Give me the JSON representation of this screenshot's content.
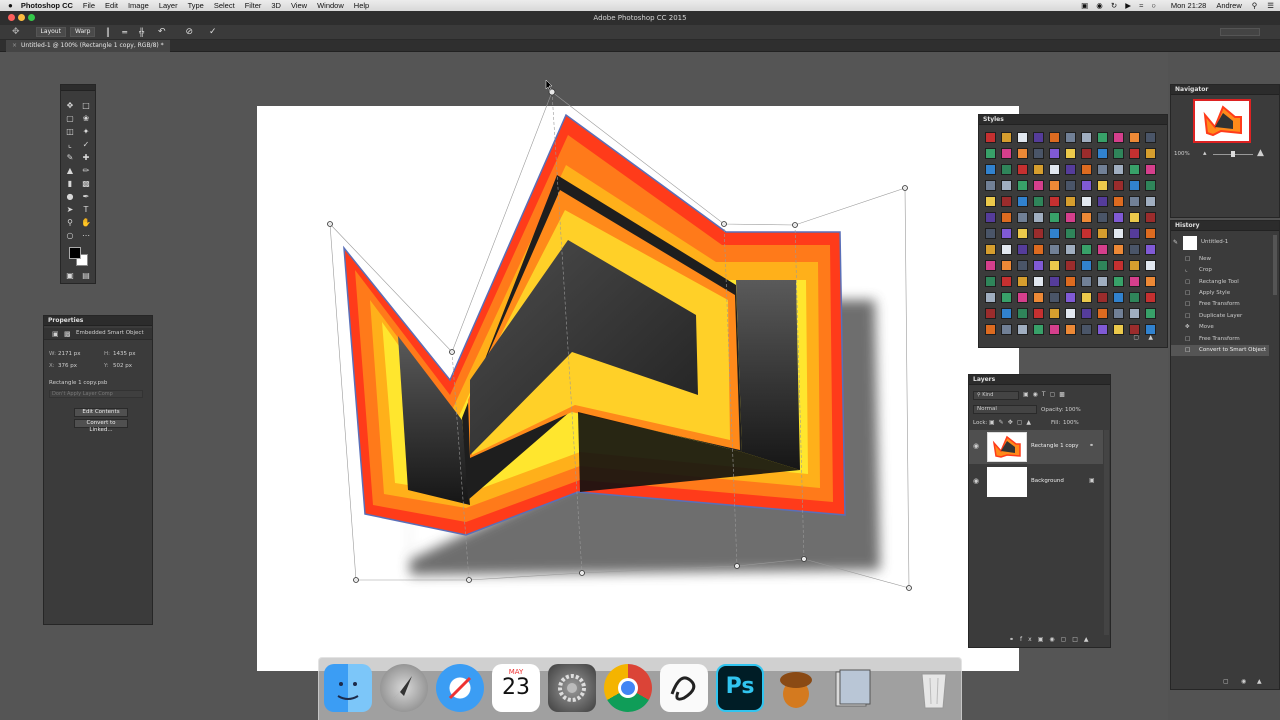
{
  "menubar": {
    "app_name": "Photoshop CC",
    "items": [
      "File",
      "Edit",
      "Image",
      "Layer",
      "Type",
      "Select",
      "Filter",
      "3D",
      "View",
      "Window",
      "Help"
    ],
    "clock": "Mon 21:28",
    "user": "Andrew"
  },
  "window": {
    "title": "Adobe Photoshop CC 2015"
  },
  "options_bar": {
    "layout_label": "Layout",
    "warp_label": "Warp"
  },
  "document_tab": {
    "title": "Untitled-1 @ 100% (Rectangle 1 copy, RGB/8) *"
  },
  "properties": {
    "title": "Properties",
    "subtitle": "Embedded Smart Object",
    "w_label": "W:",
    "w_value": "2171 px",
    "h_label": "H:",
    "h_value": "1435 px",
    "x_label": "X:",
    "x_value": "376 px",
    "y_label": "Y:",
    "y_value": "502 px",
    "filename": "Rectangle 1 copy.psb",
    "layer_comp": "Don't Apply Layer Comp",
    "edit_button": "Edit Contents",
    "convert_button": "Convert to Linked..."
  },
  "styles_panel": {
    "title": "Styles"
  },
  "layers": {
    "title": "Layers",
    "filter": "Kind",
    "blend_mode": "Normal",
    "opacity_label": "Opacity:",
    "opacity_value": "100%",
    "lock_label": "Lock:",
    "fill_label": "Fill:",
    "fill_value": "100%",
    "items": [
      {
        "name": "Rectangle 1 copy"
      },
      {
        "name": "Background"
      }
    ]
  },
  "navigator": {
    "title": "Navigator",
    "zoom": "100%"
  },
  "history": {
    "title": "History",
    "snapshot": "Untitled-1",
    "items": [
      "New",
      "Crop",
      "Rectangle Tool",
      "Apply Style",
      "Free Transform",
      "Duplicate Layer",
      "Move",
      "Free Transform",
      "Convert to Smart Object"
    ]
  },
  "dock": {
    "calendar_month": "MAY",
    "calendar_day": "23",
    "photoshop_label": "Ps"
  },
  "colors": {
    "canvas_bg": "#ffffff",
    "shape_outer": "#ff3b1a",
    "shape_mid": "#ff9a1a",
    "shape_inner": "#ffee33",
    "panel_bg": "#3b3b3b",
    "workspace_bg": "#555555",
    "selected_layer": "#4f4f4f"
  }
}
